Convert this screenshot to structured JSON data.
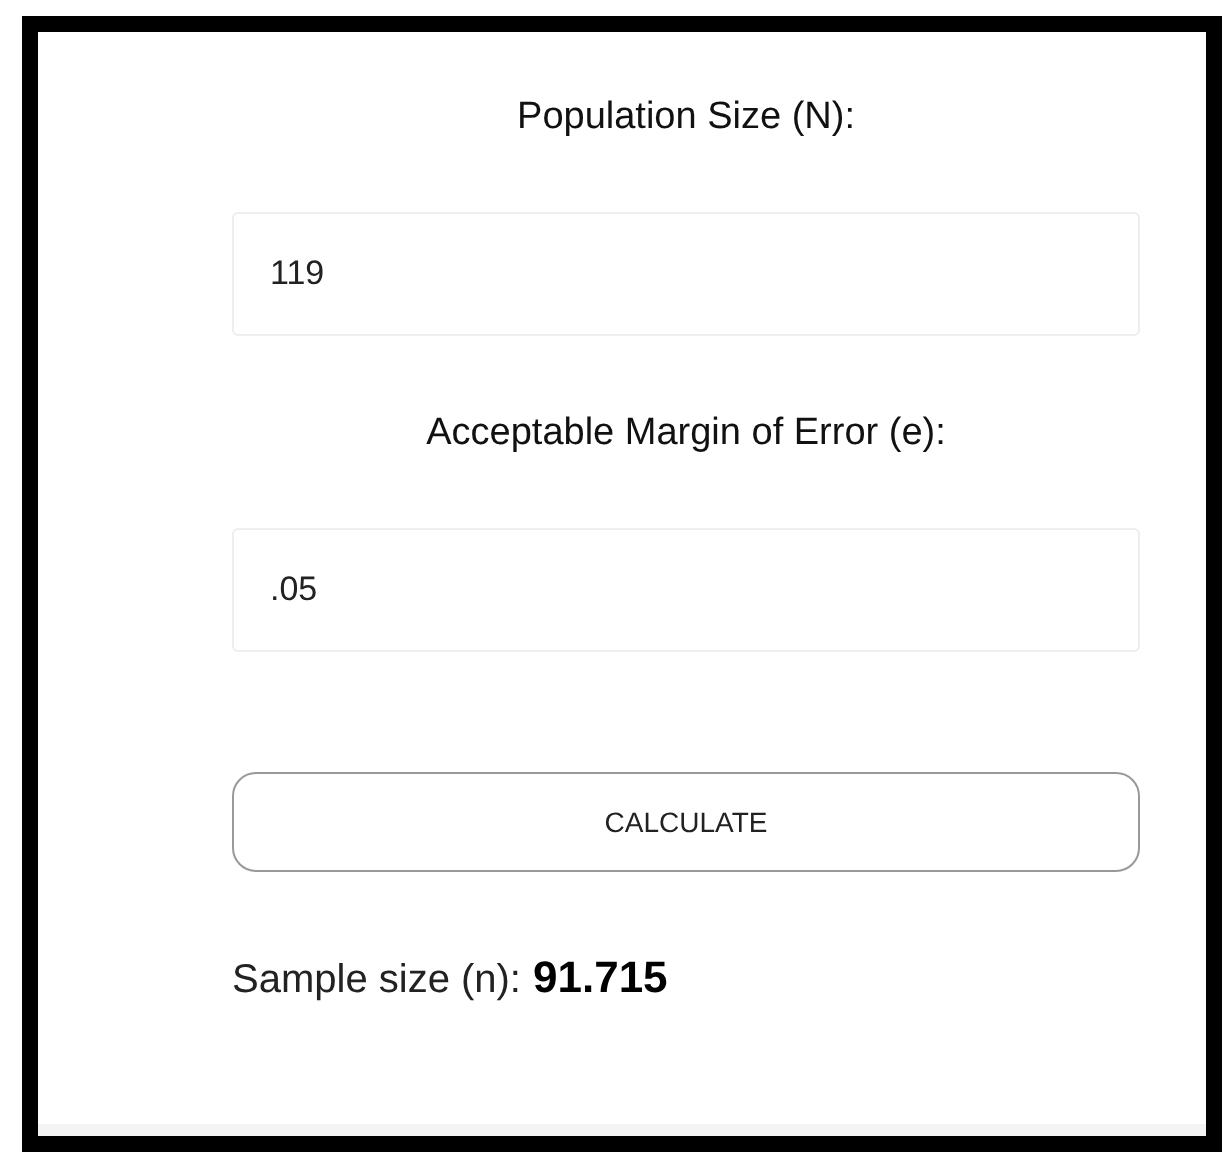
{
  "fields": [
    {
      "label": "Population Size (N):",
      "value": "119"
    },
    {
      "label": "Acceptable Margin of Error (e):",
      "value": ".05"
    }
  ],
  "button": "CALCULATE",
  "result": {
    "label": "Sample size (n):",
    "value": "91.715"
  }
}
